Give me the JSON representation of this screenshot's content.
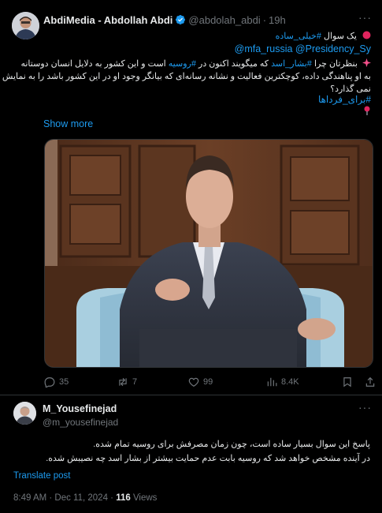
{
  "tweet": {
    "name": "AbdiMedia - Abdollah Abdi",
    "handle": "@abdolah_abdi",
    "time": "19h",
    "more_icon": "···",
    "line1_text": "یک سوال ",
    "line1_tag": "#خیلی_ساده",
    "line2_mentions": "@mfa_russia @Presidency_Sy",
    "line3_a": "بنظرتان چرا ",
    "line3_tag1": "#بشار_اسد",
    "line3_b": " که میگویند اکنون در ",
    "line3_tag2": "#روسیه",
    "line3_c": " است و این کشور به دلایل انسان دوستانه",
    "line4": "به او پناهندگی داده، کوچکترین فعالیت و نشانه رسانه‌ای که بیانگر وجود او در این کشور باشد را به نمایش",
    "line5": "نمی گذارد؟",
    "line6_tag": "#برای_فرداها",
    "show_more": "Show more",
    "stats": {
      "replies": "35",
      "reposts": "7",
      "likes": "99",
      "views": "8.4K"
    }
  },
  "reply": {
    "name": "M_Yousefinejad",
    "handle": "@m_yousefinejad",
    "more_icon": "···",
    "line1": "پاسخ این سوال بسیار ساده است، چون زمان مصرفش برای روسیه تمام شده.",
    "line2": "در آینده مشخص خواهد شد که روسیه بابت عدم حمایت بیشتر از بشار اسد چه نصیبش شده.",
    "translate": "Translate post",
    "timestamp": "8:49 AM · Dec 11, 2024 · ",
    "views_count": "116",
    "views_label": " Views"
  },
  "icons": [
    "verified-badge-icon",
    "red-circle-icon",
    "sparkle-icon",
    "pin-icon",
    "reply-icon",
    "repost-icon",
    "like-icon",
    "views-icon",
    "bookmark-icon",
    "share-icon"
  ]
}
